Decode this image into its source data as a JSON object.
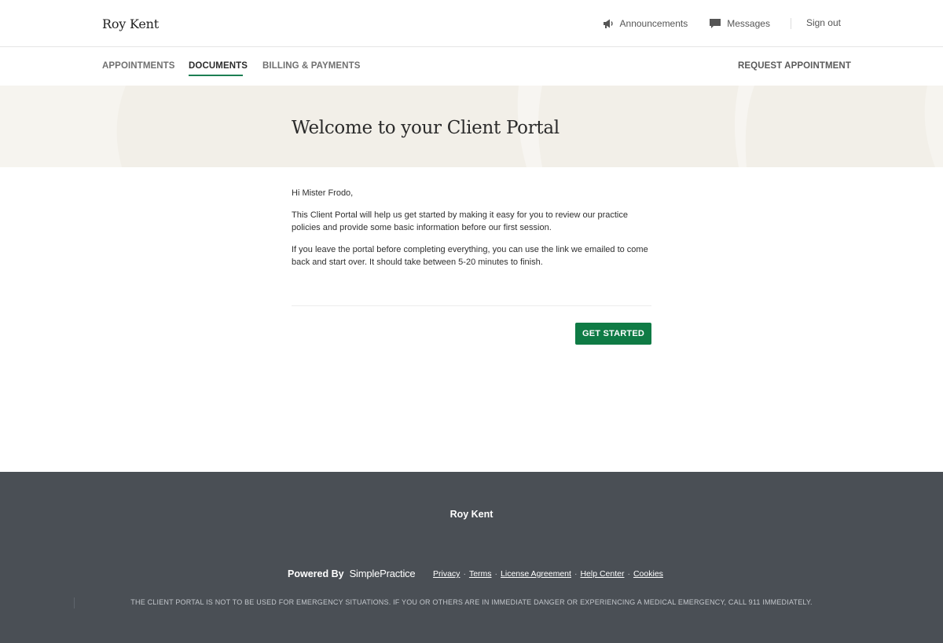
{
  "header": {
    "brand": "Roy Kent",
    "announcements_label": "Announcements",
    "messages_label": "Messages",
    "signout_label": "Sign out"
  },
  "nav": {
    "tabs": [
      {
        "label": "APPOINTMENTS",
        "active": false
      },
      {
        "label": "DOCUMENTS",
        "active": true
      },
      {
        "label": "BILLING & PAYMENTS",
        "active": false
      }
    ],
    "request_label": "REQUEST APPOINTMENT"
  },
  "banner": {
    "title": "Welcome to your Client Portal"
  },
  "content": {
    "greeting": "Hi Mister Frodo,",
    "paragraph1": "This Client Portal will help us get started by making it easy for you to review our practice policies and provide some basic information before our first session.",
    "paragraph2": "If you leave the portal before completing everything, you can use the link we emailed to come back and start over. It should take between 5-20 minutes to finish.",
    "button_label": "GET STARTED"
  },
  "footer": {
    "name": "Roy Kent",
    "powered_by": "Powered By",
    "logo_text": "SimplePractice",
    "links": [
      "Privacy",
      "Terms",
      "License Agreement",
      "Help Center",
      "Cookies"
    ],
    "separator": "·",
    "disclaimer": "THE CLIENT PORTAL IS NOT TO BE USED FOR EMERGENCY SITUATIONS. IF YOU OR OTHERS ARE IN IMMEDIATE DANGER OR EXPERIENCING A MEDICAL EMERGENCY, CALL 911 IMMEDIATELY."
  },
  "colors": {
    "accent_green": "#0f7b45",
    "banner_bg": "#f2efe8",
    "footer_bg": "#4a4f55"
  },
  "icons": {
    "announcements": "megaphone-icon",
    "messages": "chat-bubble-icon"
  }
}
